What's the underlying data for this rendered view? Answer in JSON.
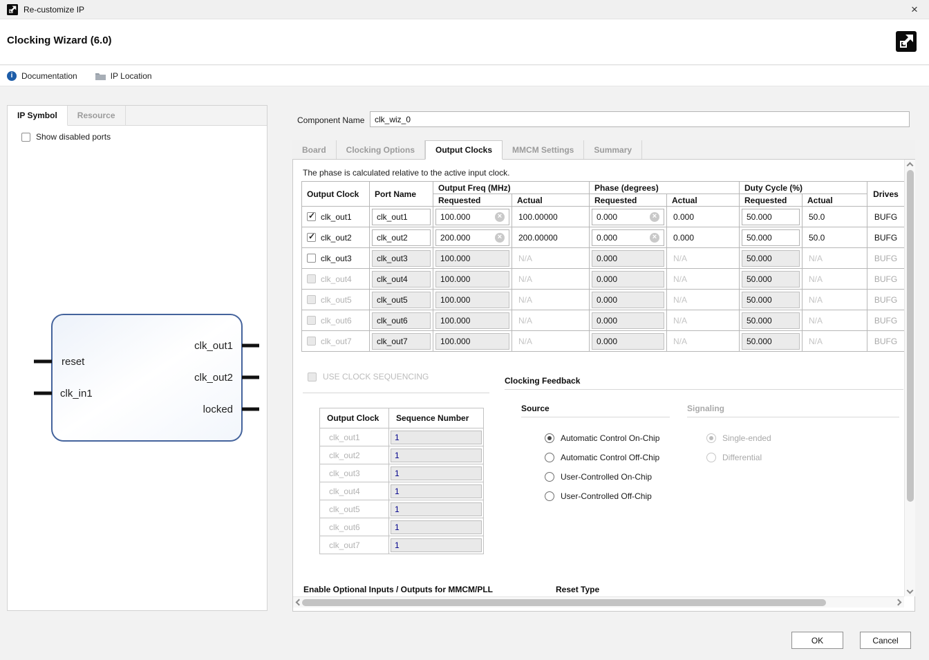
{
  "window": {
    "title": "Re-customize IP",
    "close_glyph": "×"
  },
  "header": {
    "title": "Clocking Wizard (6.0)"
  },
  "toolbar": {
    "documentation": "Documentation",
    "ip_location": "IP Location",
    "info_glyph": "i"
  },
  "left_panel": {
    "tabs": [
      {
        "label": "IP Symbol"
      },
      {
        "label": "Resource"
      }
    ],
    "show_disabled_ports": "Show disabled ports",
    "ip_symbol": {
      "inputs": [
        "reset",
        "clk_in1"
      ],
      "outputs": [
        "clk_out1",
        "clk_out2",
        "locked"
      ]
    }
  },
  "component": {
    "label": "Component Name",
    "value": "clk_wiz_0"
  },
  "main_tabs": [
    {
      "label": "Board"
    },
    {
      "label": "Clocking Options"
    },
    {
      "label": "Output Clocks"
    },
    {
      "label": "MMCM Settings"
    },
    {
      "label": "Summary"
    }
  ],
  "output_clocks_tab": {
    "note": "The phase is calculated relative to the active input clock.",
    "table": {
      "headers": {
        "output_clock": "Output Clock",
        "port_name": "Port Name",
        "output_freq": "Output Freq (MHz)",
        "phase": "Phase (degrees)",
        "duty_cycle": "Duty Cycle (%)",
        "requested": "Requested",
        "actual": "Actual",
        "drives": "Drives"
      },
      "rows": [
        {
          "clock": "clk_out1",
          "port": "clk_out1",
          "freq_requested": "100.000",
          "freq_actual": "100.00000",
          "phase_requested": "0.000",
          "phase_actual": "0.000",
          "duty_requested": "50.000",
          "duty_actual": "50.0",
          "drives": "BUFG"
        },
        {
          "clock": "clk_out2",
          "port": "clk_out2",
          "freq_requested": "200.000",
          "freq_actual": "200.00000",
          "phase_requested": "0.000",
          "phase_actual": "0.000",
          "duty_requested": "50.000",
          "duty_actual": "50.0",
          "drives": "BUFG"
        },
        {
          "clock": "clk_out3",
          "port": "clk_out3",
          "freq_requested": "100.000",
          "freq_actual": "N/A",
          "phase_requested": "0.000",
          "phase_actual": "N/A",
          "duty_requested": "50.000",
          "duty_actual": "N/A",
          "drives": "BUFG"
        },
        {
          "clock": "clk_out4",
          "port": "clk_out4",
          "freq_requested": "100.000",
          "freq_actual": "N/A",
          "phase_requested": "0.000",
          "phase_actual": "N/A",
          "duty_requested": "50.000",
          "duty_actual": "N/A",
          "drives": "BUFG"
        },
        {
          "clock": "clk_out5",
          "port": "clk_out5",
          "freq_requested": "100.000",
          "freq_actual": "N/A",
          "phase_requested": "0.000",
          "phase_actual": "N/A",
          "duty_requested": "50.000",
          "duty_actual": "N/A",
          "drives": "BUFG"
        },
        {
          "clock": "clk_out6",
          "port": "clk_out6",
          "freq_requested": "100.000",
          "freq_actual": "N/A",
          "phase_requested": "0.000",
          "phase_actual": "N/A",
          "duty_requested": "50.000",
          "duty_actual": "N/A",
          "drives": "BUFG"
        },
        {
          "clock": "clk_out7",
          "port": "clk_out7",
          "freq_requested": "100.000",
          "freq_actual": "N/A",
          "phase_requested": "0.000",
          "phase_actual": "N/A",
          "duty_requested": "50.000",
          "duty_actual": "N/A",
          "drives": "BUFG"
        }
      ]
    },
    "use_clock_sequencing": "USE CLOCK SEQUENCING",
    "sequence_table": {
      "headers": {
        "output_clock": "Output Clock",
        "sequence_number": "Sequence Number"
      },
      "rows": [
        {
          "clock": "clk_out1",
          "seq": "1"
        },
        {
          "clock": "clk_out2",
          "seq": "1"
        },
        {
          "clock": "clk_out3",
          "seq": "1"
        },
        {
          "clock": "clk_out4",
          "seq": "1"
        },
        {
          "clock": "clk_out5",
          "seq": "1"
        },
        {
          "clock": "clk_out6",
          "seq": "1"
        },
        {
          "clock": "clk_out7",
          "seq": "1"
        }
      ]
    },
    "clocking_feedback": {
      "title": "Clocking Feedback",
      "source": {
        "title": "Source",
        "selected": "Automatic Control On-Chip",
        "options": [
          {
            "label": "Automatic Control On-Chip"
          },
          {
            "label": "Automatic Control Off-Chip"
          },
          {
            "label": "User-Controlled On-Chip"
          },
          {
            "label": "User-Controlled Off-Chip"
          }
        ]
      },
      "signaling": {
        "title": "Signaling",
        "selected": "Single-ended",
        "options": [
          {
            "label": "Single-ended"
          },
          {
            "label": "Differential"
          }
        ]
      }
    },
    "sections": {
      "optional_io": "Enable Optional Inputs / Outputs for MMCM/PLL",
      "reset_type": "Reset Type"
    }
  },
  "footer": {
    "ok": "OK",
    "cancel": "Cancel"
  },
  "colors": {
    "ip_block_border": "#44639c",
    "info_icon": "#1d5da8",
    "logo": "#0b0b0b",
    "accent_navy": "#00008b"
  }
}
